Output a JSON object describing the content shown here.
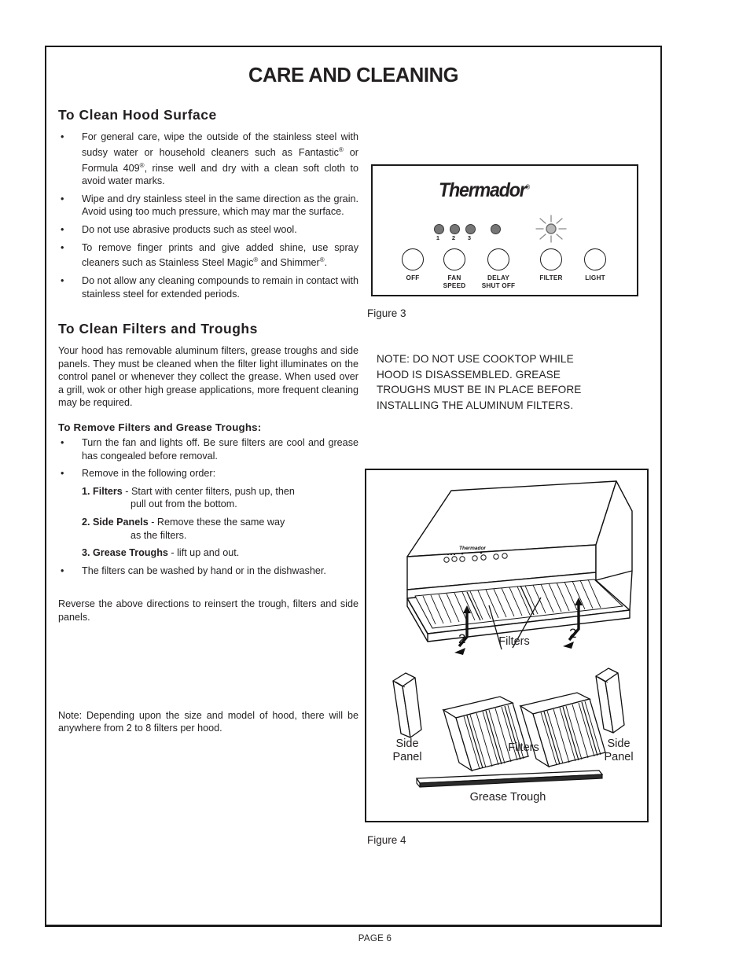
{
  "document": {
    "title": "CARE AND CLEANING",
    "footer_page": "PAGE 6"
  },
  "sections": {
    "clean_hood": {
      "heading": "To Clean Hood Surface",
      "bullets": [
        "For general care, wipe the outside of the stainless steel with  sudsy water or household cleaners such as Fantastic® or Formula 409®, rinse well and dry with a clean soft cloth to avoid water marks.",
        "Wipe and dry stainless steel in the same direction as the grain.  Avoid using too much pressure, which may mar the surface.",
        "Do not use abrasive products such as steel wool.",
        "To remove finger prints and give added shine, use spray cleaners such as Stainless Steel Magic® and Shimmer®.",
        "Do not allow any cleaning compounds to remain in contact with stainless steel for extended periods."
      ]
    },
    "clean_filters": {
      "heading": "To Clean Filters and Troughs",
      "intro": "Your hood has removable aluminum filters, grease troughs and side panels. They must be cleaned when the filter light illuminates on the control panel or whenever they collect the grease.  When used over a grill, wok or other high grease applications, more frequent cleaning may be required.",
      "subheading": "To Remove Filters and Grease Troughs:",
      "bullet1": "Turn the fan and lights off.   Be sure filters are cool and grease has congealed before removal.",
      "bullet2": "Remove in the following order:",
      "steps": [
        {
          "label": "1. Filters",
          "dash": "-",
          "text": "Start with center filters, push up, then",
          "cont": "pull out from the bottom."
        },
        {
          "label": "2. Side Panels",
          "dash": "-",
          "text": "Remove these the same way",
          "cont": "as the filters."
        },
        {
          "label": "3. Grease Troughs",
          "dash": "-",
          "text": "lift up and out.",
          "cont": ""
        }
      ],
      "bullet3": "The filters can be washed by hand or in the dishwasher.",
      "reverse_note": "Reverse the above directions to reinsert the trough, filters and side panels.",
      "bottom_note": "Note:  Depending upon the size and model of hood, there will be anywhere from 2 to 8 filters per hood."
    }
  },
  "note_block": {
    "line1": "NOTE: DO NOT USE COOKTOP WHILE",
    "line2": "HOOD IS DISASSEMBLED.   GREASE",
    "line3": "TROUGHS MUST BE IN PLACE BEFORE",
    "line4": "INSTALLING THE ALUMINUM FILTERS."
  },
  "figure3": {
    "caption": "Figure  3",
    "brand": "Thermador",
    "registered_mark": "®",
    "led_numbers": [
      "1",
      "2",
      "3"
    ],
    "buttons": [
      {
        "name": "off",
        "label": "OFF"
      },
      {
        "name": "fan-speed",
        "label": "FAN\nSPEED",
        "line1": "FAN",
        "line2": "SPEED"
      },
      {
        "name": "delay-shut-off",
        "label": "DELAY\nSHUT OFF",
        "line1": "DELAY",
        "line2": "SHUT OFF"
      },
      {
        "name": "filter",
        "label": "FILTER"
      },
      {
        "name": "light",
        "label": "LIGHT"
      }
    ],
    "led_color": "#767676",
    "filter_indicator_color": "#b0b0b0"
  },
  "figure4": {
    "caption": "Figure  4",
    "labels": {
      "filters_top": "Filters",
      "filters_bottom": "Filters",
      "side_panel_left_l1": "Side",
      "side_panel_left_l2": "Panel",
      "side_panel_right_l1": "Side",
      "side_panel_right_l2": "Panel",
      "grease_trough": "Grease Trough",
      "callout_left": "2",
      "callout_right": "2"
    }
  }
}
